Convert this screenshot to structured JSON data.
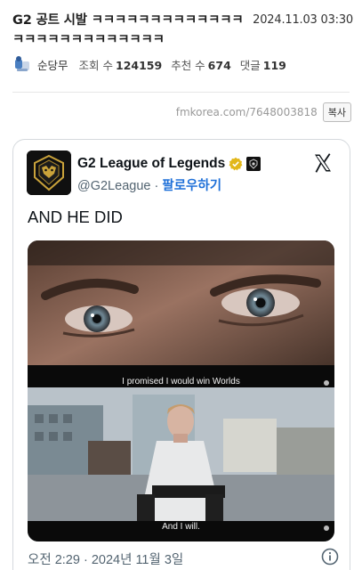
{
  "post": {
    "title_line1": "G2 공트 시발 ㅋㅋㅋㅋㅋㅋㅋㅋㅋㅋㅋㅋㅋ",
    "date": "2024.11.03 03:30",
    "title_line2": "ㅋㅋㅋㅋㅋㅋㅋㅋㅋㅋㅋㅋㅋ",
    "author": "순당무",
    "views_label": "조회 수",
    "views": "124159",
    "upvotes_label": "추천 수",
    "upvotes": "674",
    "comments_label": "댓글",
    "comments": "119",
    "short_url": "fmkorea.com/7648003818",
    "copy_label": "복사"
  },
  "tweet": {
    "display_name": "G2 League of Legends",
    "handle": "@G2League",
    "separator": "·",
    "follow_label": "팔로우하기",
    "text": "AND HE DID",
    "caption_top": "I promised I would win Worlds",
    "caption_bottom": "And I will.",
    "timestamp": "오전 2:29 · 2024년 11월 3일"
  },
  "icons": {
    "author": "author-avatar-icon",
    "verified": "verified-badge-icon",
    "affiliate": "affiliate-badge-icon",
    "x_logo": "x-logo-icon",
    "info": "info-icon"
  },
  "colors": {
    "verified_gold": "#e2b719",
    "follow_blue": "#1d6fd8",
    "muted_text": "#536471"
  }
}
